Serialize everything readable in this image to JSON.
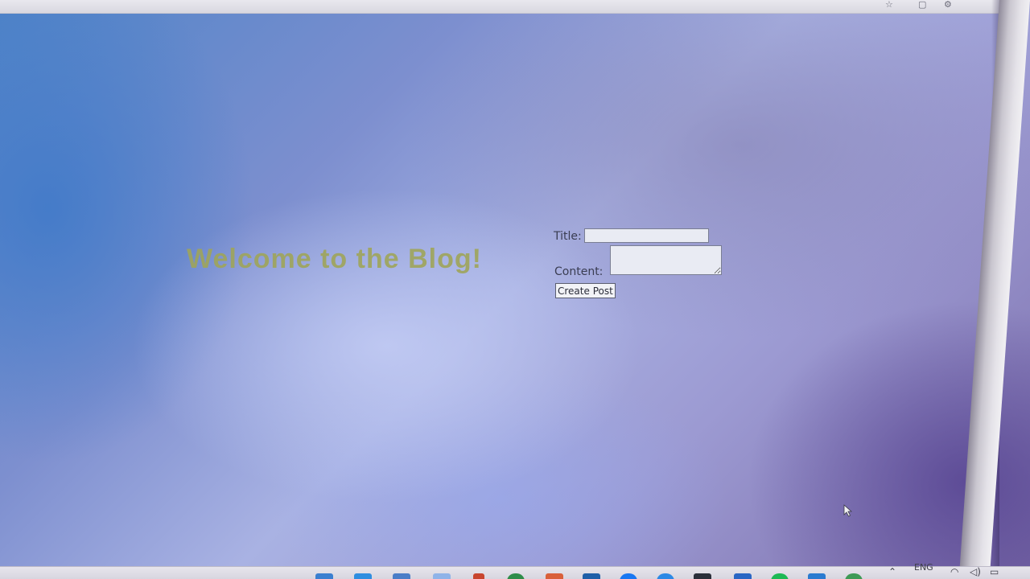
{
  "page": {
    "heading": "Welcome to the Blog!"
  },
  "form": {
    "title_label": "Title:",
    "title_value": "",
    "content_label": "Content:",
    "content_value": "",
    "submit_label": "Create Post"
  },
  "browser": {
    "icons": [
      "star-icon",
      "extensions-icon",
      "settings-icon"
    ]
  },
  "taskbar": {
    "language": "ENG",
    "icons": [
      "file-explorer-icon",
      "mail-icon",
      "store-icon",
      "app-icon",
      "app-icon",
      "chrome-icon",
      "app-icon",
      "app-icon",
      "facebook-icon",
      "app-icon",
      "terminal-icon",
      "app-icon",
      "spotify-icon",
      "vscode-icon",
      "app-icon"
    ],
    "tray_icons": [
      "chevron-up-icon",
      "wifi-icon",
      "volume-icon",
      "battery-icon"
    ]
  },
  "colors": {
    "heading": "#9fa55a",
    "background_left": "#4f84c8",
    "background_center": "#a9b2e3",
    "background_right": "#7a6ba8"
  }
}
